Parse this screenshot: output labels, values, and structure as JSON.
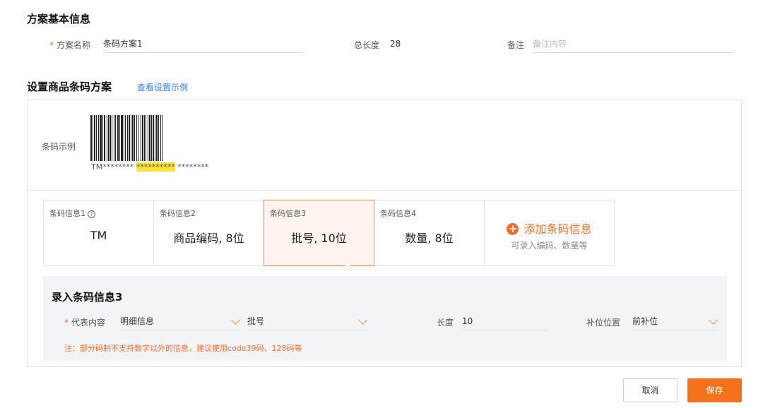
{
  "basic": {
    "title": "方案基本信息",
    "name_label": "方案名称",
    "name_value": "条码方案1",
    "total_length_label": "总长度",
    "total_length_value": "28",
    "remark_label": "备注",
    "remark_placeholder": "备注内容"
  },
  "setup": {
    "title": "设置商品条码方案",
    "example_link": "查看设置示例",
    "barcode_label": "条码示例",
    "barcode_text": {
      "prefix": "TM",
      "seg1": "********",
      "seg2": "**********",
      "seg3": "********"
    }
  },
  "cards": [
    {
      "caption": "条码信息1",
      "value": "TM",
      "help_icon": "?"
    },
    {
      "caption": "条码信息2",
      "value": "商品编码, 8位"
    },
    {
      "caption": "条码信息3",
      "value": "批号, 10位"
    },
    {
      "caption": "条码信息4",
      "value": "数量, 8位"
    }
  ],
  "add_card": {
    "icon": "+",
    "title": "添加条码信息",
    "subtitle": "可录入编码、数量等"
  },
  "entry": {
    "title": "录入条码信息3",
    "represent_label": "代表内容",
    "represent_value": "明细信息",
    "type_value": "批号",
    "length_label": "长度",
    "length_value": "10",
    "pad_label": "补位位置",
    "pad_value": "前补位",
    "note": "注：部分码制不支持数字以外的信息，建议使用code39码、128码等"
  },
  "actions": {
    "cancel": "取消",
    "save": "保存"
  },
  "colors": {
    "accent": "#f56c2a",
    "link": "#3b7cf6",
    "active_card_bg": "#fff4ed",
    "highlight": "#ffe234"
  }
}
